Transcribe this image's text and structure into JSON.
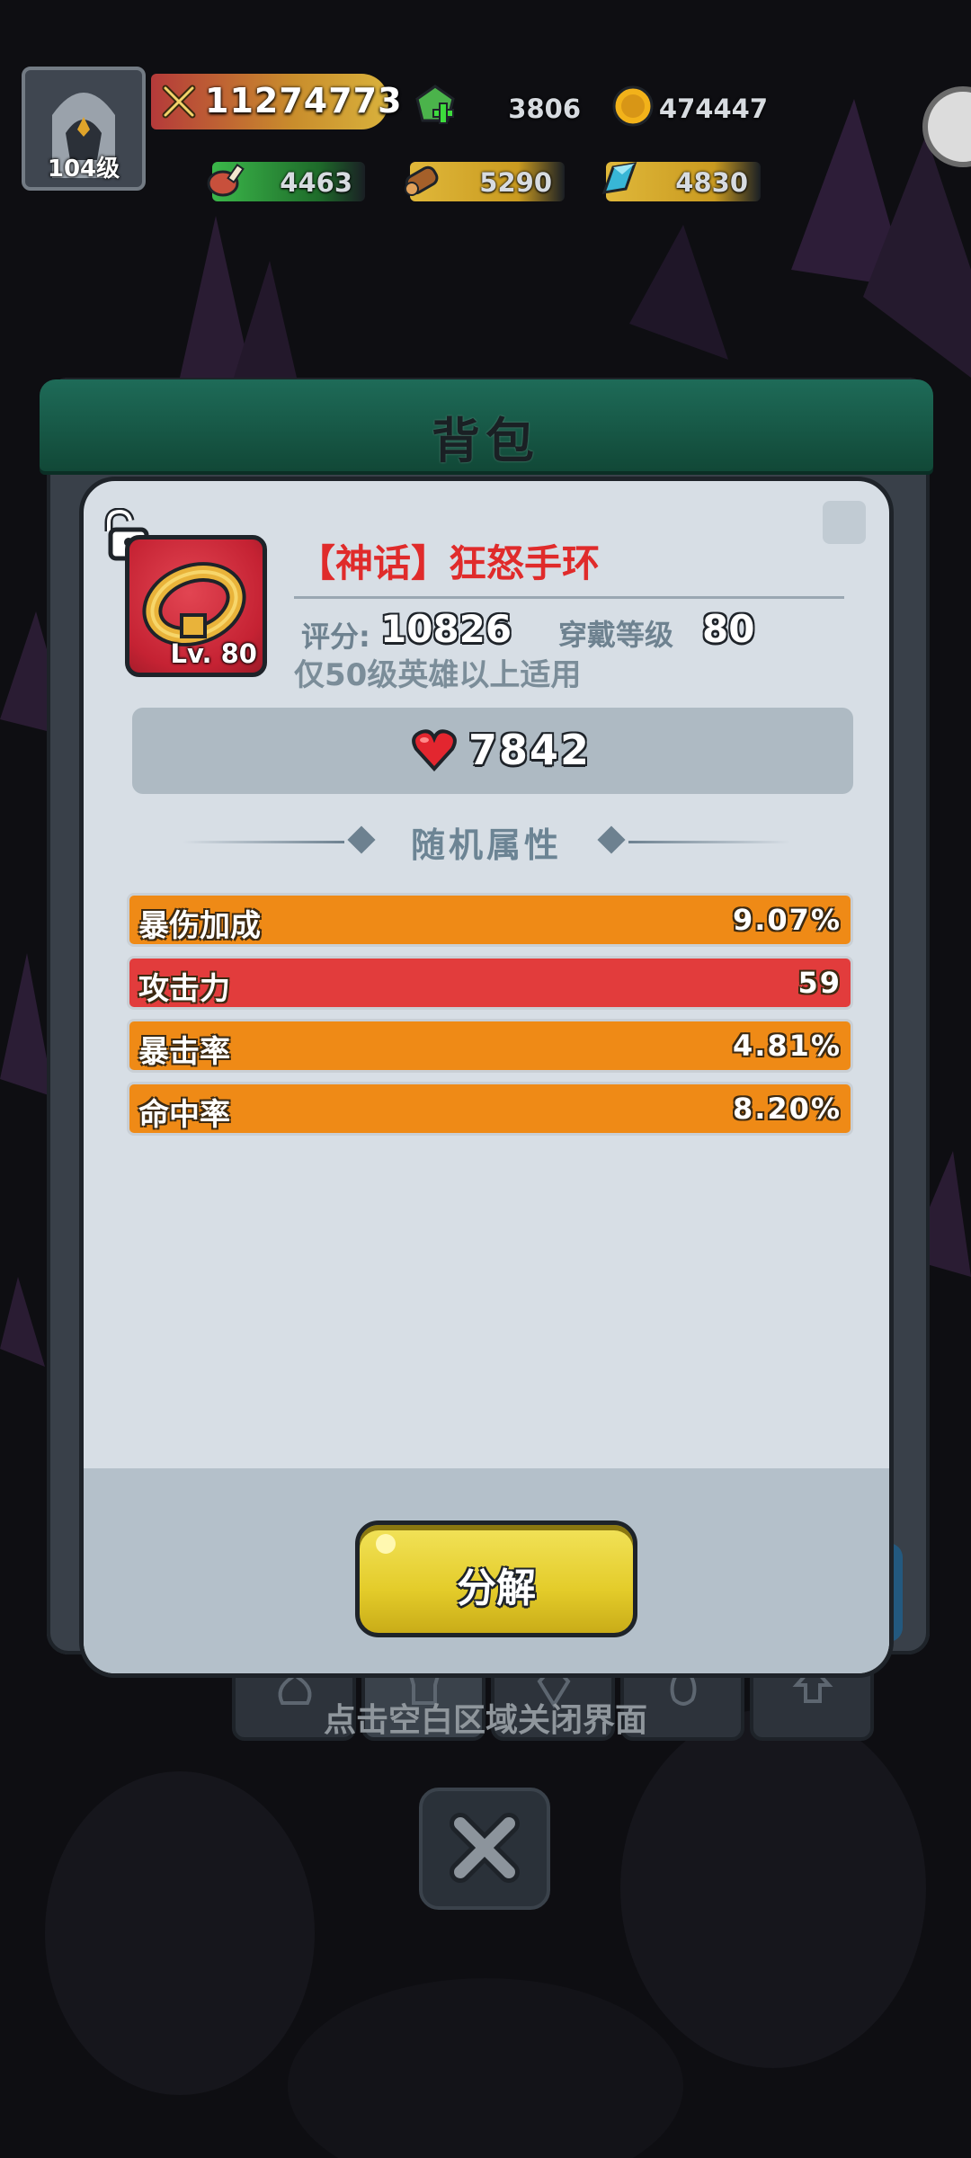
{
  "hud": {
    "player_level": "104级",
    "combat_power": "11274773",
    "gems": "3806",
    "gold": "474447",
    "meat": "4463",
    "wood": "5290",
    "crystal": "4830"
  },
  "backpack": {
    "title": "背包"
  },
  "item": {
    "name": "【神话】狂怒手环",
    "level_badge": "Lv. 80",
    "score_label": "评分:",
    "score": "10826",
    "equip_level_label": "穿戴等级",
    "equip_level": "80",
    "restriction": "仅50级英雄以上适用",
    "hp": "7842",
    "random_attrs_title": "随机属性",
    "attributes": [
      {
        "name": "暴伤加成",
        "value": "9.07%",
        "color": "#ef8a16"
      },
      {
        "name": "攻击力",
        "value": "59",
        "color": "#e23c3c"
      },
      {
        "name": "暴击率",
        "value": "4.81%",
        "color": "#ef8a16"
      },
      {
        "name": "命中率",
        "value": "8.20%",
        "color": "#ef8a16"
      }
    ],
    "decompose_label": "分解"
  },
  "hint": "点击空白区域关闭界面",
  "colors": {
    "popup_bg": "#d7dee5",
    "name_red": "#e02b2b",
    "button_yellow": "#e8d030",
    "header_green": "#1e6b58"
  }
}
